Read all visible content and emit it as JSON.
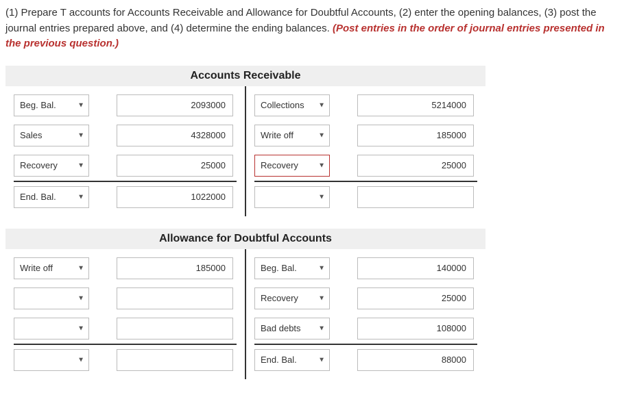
{
  "instructions": {
    "main": "(1) Prepare T accounts for Accounts Receivable and Allowance for Doubtful Accounts, (2) enter the opening balances, (3) post the journal entries prepared above, and (4) determine the ending balances. ",
    "red": "(Post entries in the order of journal entries presented in the previous question.)"
  },
  "accounts": {
    "ar": {
      "title": "Accounts Receivable",
      "left": [
        {
          "label": "Beg. Bal.",
          "value": "2093000"
        },
        {
          "label": "Sales",
          "value": "4328000"
        },
        {
          "label": "Recovery",
          "value": "25000"
        }
      ],
      "right": [
        {
          "label": "Collections",
          "value": "5214000"
        },
        {
          "label": "Write off",
          "value": "185000"
        },
        {
          "label": "Recovery",
          "value": "25000",
          "highlighted": true
        }
      ],
      "left_end": {
        "label": "End. Bal.",
        "value": "1022000"
      },
      "right_end": {
        "label": "",
        "value": ""
      }
    },
    "ada": {
      "title": "Allowance for Doubtful Accounts",
      "left": [
        {
          "label": "Write off",
          "value": "185000"
        },
        {
          "label": "",
          "value": ""
        },
        {
          "label": "",
          "value": ""
        }
      ],
      "right": [
        {
          "label": "Beg. Bal.",
          "value": "140000"
        },
        {
          "label": "Recovery",
          "value": "25000"
        },
        {
          "label": "Bad debts",
          "value": "108000"
        }
      ],
      "left_end": {
        "label": "",
        "value": ""
      },
      "right_end": {
        "label": "End. Bal.",
        "value": "88000"
      }
    }
  }
}
